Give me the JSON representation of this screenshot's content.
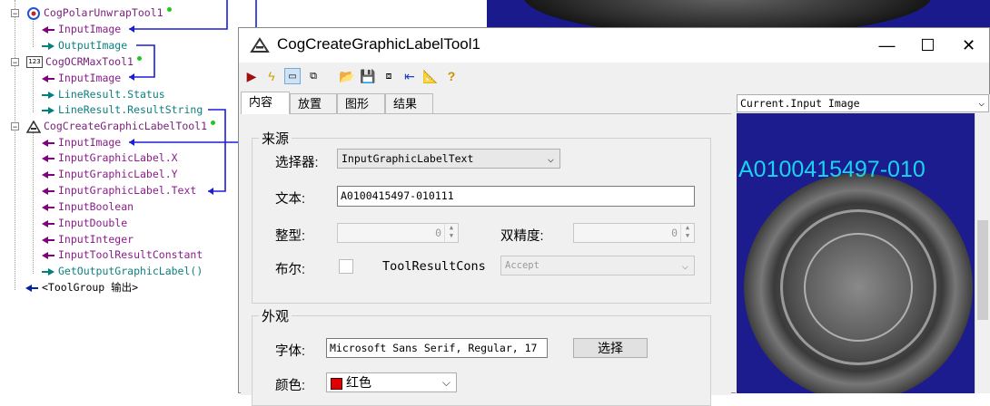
{
  "tree": {
    "items": [
      {
        "kind": "tool",
        "label": "CogPolarUnwrapTool1",
        "icon": "polar-unwrap-icon"
      },
      {
        "kind": "in",
        "label": "InputImage"
      },
      {
        "kind": "out",
        "label": "OutputImage"
      },
      {
        "kind": "tool",
        "label": "CogOCRMaxTool1",
        "icon": "ocr-icon",
        "icon_text": "123"
      },
      {
        "kind": "in",
        "label": "InputImage"
      },
      {
        "kind": "out",
        "label": "LineResult.Status"
      },
      {
        "kind": "out",
        "label": "LineResult.ResultString"
      },
      {
        "kind": "tool",
        "label": "CogCreateGraphicLabelTool1",
        "icon": "graphic-label-icon"
      },
      {
        "kind": "in",
        "label": "InputImage"
      },
      {
        "kind": "in",
        "label": "InputGraphicLabel.X"
      },
      {
        "kind": "in",
        "label": "InputGraphicLabel.Y"
      },
      {
        "kind": "in",
        "label": "InputGraphicLabel.Text"
      },
      {
        "kind": "in",
        "label": "InputBoolean"
      },
      {
        "kind": "in",
        "label": "InputDouble"
      },
      {
        "kind": "in",
        "label": "InputInteger"
      },
      {
        "kind": "in",
        "label": "InputToolResultConstant"
      },
      {
        "kind": "out",
        "label": "GetOutputGraphicLabel()"
      },
      {
        "kind": "group",
        "label": "<ToolGroup 输出>"
      }
    ],
    "link_color": "#1d1dd6"
  },
  "dialog": {
    "title": "CogCreateGraphicLabelTool1",
    "tabs": [
      "内容",
      "放置",
      "图形",
      "结果"
    ],
    "active_tab": "内容",
    "source": {
      "title": "来源",
      "selector_label": "选择器:",
      "selector_value": "InputGraphicLabelText",
      "text_label": "文本:",
      "text_value": "A0100415497-010111",
      "int_label": "整型:",
      "int_value": "0",
      "double_label": "双精度:",
      "double_value": "0",
      "bool_label": "布尔:",
      "result_label": "ToolResultCons",
      "result_value": "Accept"
    },
    "appearance": {
      "title": "外观",
      "font_label": "字体:",
      "font_value": "Microsoft Sans Serif, Regular, 17",
      "font_button": "选择",
      "color_label": "颜色:",
      "color_value": "红色",
      "color_swatch": "#e00000"
    }
  },
  "viewer": {
    "selection": "Current.Input Image",
    "overlay_text": "A0100415497-010",
    "overlay_color": "#19d4ee",
    "background": "#1c1c8e"
  }
}
